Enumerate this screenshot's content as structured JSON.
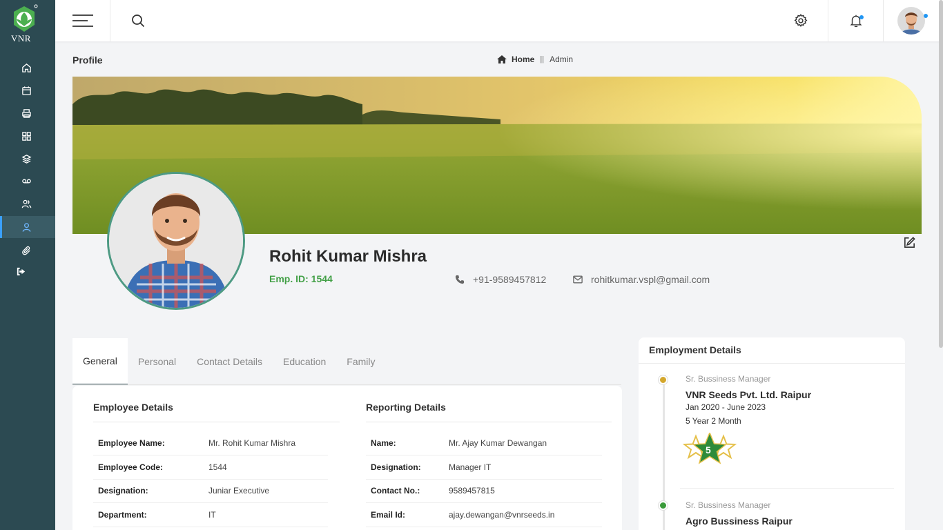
{
  "brand": {
    "logo_text": "VNR"
  },
  "sidebar": {
    "items": [
      {
        "icon": "home-icon"
      },
      {
        "icon": "calendar-icon"
      },
      {
        "icon": "printer-icon"
      },
      {
        "icon": "grid-icon"
      },
      {
        "icon": "layers-icon"
      },
      {
        "icon": "voicemail-icon"
      },
      {
        "icon": "users-icon"
      },
      {
        "icon": "user-icon",
        "active": true
      },
      {
        "icon": "paperclip-icon"
      },
      {
        "icon": "logout-icon"
      }
    ]
  },
  "header": {
    "page_title": "Profile",
    "breadcrumb": {
      "home": "Home",
      "separator": "||",
      "current": "Admin"
    }
  },
  "profile": {
    "name": "Rohit Kumar Mishra",
    "emp_id": "Emp. ID: 1544",
    "phone": "+91-9589457812",
    "email": "rohitkumar.vspl@gmail.com"
  },
  "tabs": [
    "General",
    "Personal",
    "Contact Details",
    "Education",
    "Family"
  ],
  "active_tab": "General",
  "employee_details": {
    "title": "Employee Details",
    "rows": [
      {
        "label": "Employee Name:",
        "value": "Mr. Rohit Kumar Mishra"
      },
      {
        "label": "Employee Code:",
        "value": "1544"
      },
      {
        "label": "Designation:",
        "value": "Juniar Executive"
      },
      {
        "label": "Department:",
        "value": "IT"
      }
    ]
  },
  "reporting_details": {
    "title": "Reporting Details",
    "rows": [
      {
        "label": "Name:",
        "value": "Mr. Ajay Kumar Dewangan"
      },
      {
        "label": "Designation:",
        "value": "Manager IT"
      },
      {
        "label": "Contact No.:",
        "value": "9589457815"
      },
      {
        "label": "Email Id:",
        "value": "ajay.dewangan@vnrseeds.in"
      }
    ]
  },
  "employment": {
    "title": "Employment Details",
    "entries": [
      {
        "role": "Sr. Bussiness Manager",
        "company": "VNR Seeds Pvt. Ltd. Raipur",
        "dates": "Jan 2020 - June 2023",
        "duration": "5 Year 2 Month",
        "badge": "5",
        "dot_color": "#d4a72c"
      },
      {
        "role": "Sr. Bussiness Manager",
        "company": "Agro Bussiness Raipur",
        "dot_color": "#3a9a3a"
      }
    ]
  },
  "colors": {
    "sidebar": "#2c4a52",
    "accent_green": "#43a047",
    "notification_dot": "#2196f3"
  }
}
